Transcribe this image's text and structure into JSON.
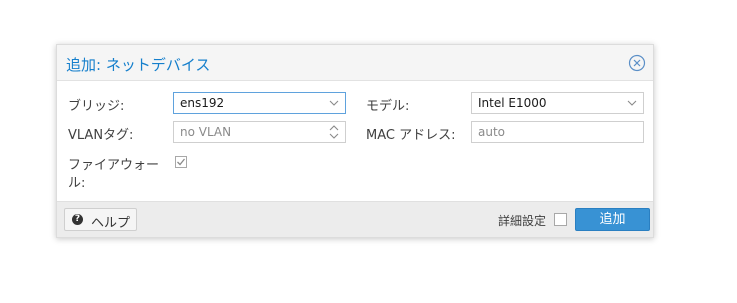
{
  "dialog": {
    "title": "追加: ネットデバイス",
    "close_icon": "close-circle-icon"
  },
  "form": {
    "bridge": {
      "label": "ブリッジ:",
      "value": "ens192",
      "icon": "chevron-down-icon"
    },
    "vlan": {
      "label": "VLANタグ:",
      "placeholder": "no VLAN",
      "icon": "spinner-updown-icon"
    },
    "firewall": {
      "label_line1": "ファイアウォー",
      "label_line2": "ル:",
      "checked": true
    },
    "model": {
      "label": "モデル:",
      "value": "Intel E1000",
      "icon": "chevron-down-icon"
    },
    "mac": {
      "label": "MAC アドレス:",
      "placeholder": "auto"
    }
  },
  "footer": {
    "help_label": "ヘルプ",
    "help_icon": "question-circle-icon",
    "advanced_label": "詳細設定",
    "advanced_checked": false,
    "add_label": "追加"
  },
  "colors": {
    "accent": "#157fcc",
    "primary_button": "#3892d4",
    "footer_bg": "#ececec",
    "title_bg": "#f5f5f5"
  }
}
